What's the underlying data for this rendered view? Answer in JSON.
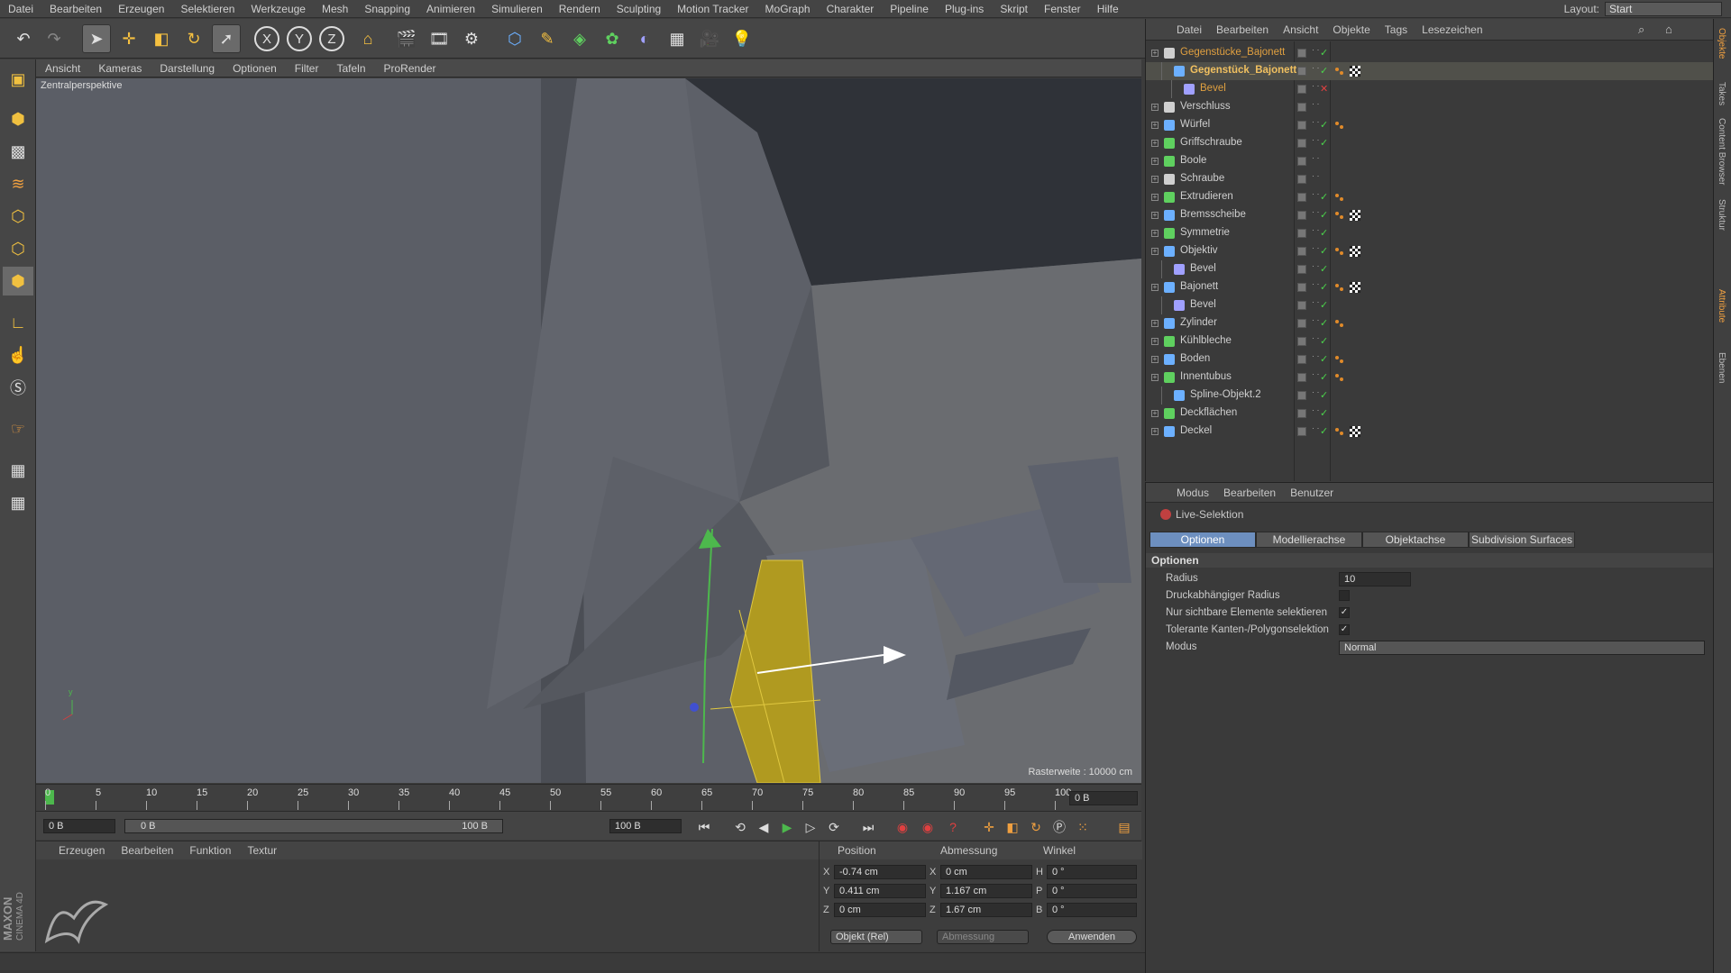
{
  "menu": [
    "Datei",
    "Bearbeiten",
    "Erzeugen",
    "Selektieren",
    "Werkzeuge",
    "Mesh",
    "Snapping",
    "Animieren",
    "Simulieren",
    "Rendern",
    "Sculpting",
    "Motion Tracker",
    "MoGraph",
    "Charakter",
    "Pipeline",
    "Plug-ins",
    "Skript",
    "Fenster",
    "Hilfe"
  ],
  "layout": {
    "label": "Layout:",
    "value": "Start"
  },
  "viewport_menu": [
    "Ansicht",
    "Kameras",
    "Darstellung",
    "Optionen",
    "Filter",
    "Tafeln",
    "ProRender"
  ],
  "viewport": {
    "label": "Zentralperspektive",
    "raster": "Rasterweite : 10000 cm"
  },
  "timeline": {
    "ticks": [
      "0",
      "5",
      "10",
      "15",
      "20",
      "25",
      "30",
      "35",
      "40",
      "45",
      "50",
      "55",
      "60",
      "65",
      "70",
      "75",
      "80",
      "85",
      "90",
      "95",
      "100"
    ],
    "current": "0 B"
  },
  "timebar": {
    "start": "0 B",
    "range_start": "0 B",
    "range_end": "100 B",
    "end": "100 B"
  },
  "material_menu": [
    "Erzeugen",
    "Bearbeiten",
    "Funktion",
    "Textur"
  ],
  "brand": {
    "line1": "MAXON",
    "line2": "CINEMA 4D"
  },
  "coords": {
    "headers": [
      "Position",
      "Abmessung",
      "Winkel"
    ],
    "rows": [
      {
        "a": "X",
        "pos": "-0.74 cm",
        "b": "X",
        "size": "0 cm",
        "c": "H",
        "rot": "0 °"
      },
      {
        "a": "Y",
        "pos": "0.411 cm",
        "b": "Y",
        "size": "1.167 cm",
        "c": "P",
        "rot": "0 °"
      },
      {
        "a": "Z",
        "pos": "0 cm",
        "b": "Z",
        "size": "1.67 cm",
        "c": "B",
        "rot": "0 °"
      }
    ],
    "mode": "Objekt (Rel)",
    "size_mode": "Abmessung",
    "apply": "Anwenden"
  },
  "object_menu": [
    "Datei",
    "Bearbeiten",
    "Ansicht",
    "Objekte",
    "Tags",
    "Lesezeichen"
  ],
  "objects": [
    {
      "name": "Gegenstücke_Bajonett",
      "indent": 0,
      "color": "#e0a040",
      "icon": "null-icon",
      "tags": "",
      "highlight": "orange"
    },
    {
      "name": "Gegenstück_Bajonett",
      "indent": 1,
      "color": "#f0c060",
      "icon": "spline-icon",
      "tags": "dots-checker",
      "highlight": "yellow"
    },
    {
      "name": "Bevel",
      "indent": 2,
      "color": "#e0a040",
      "icon": "bevel-icon",
      "tags": "",
      "highlight": "orange-dim",
      "cross": true
    },
    {
      "name": "Verschluss",
      "indent": 0,
      "color": "#cfcfcf",
      "icon": "null-icon",
      "tags": ""
    },
    {
      "name": "Würfel",
      "indent": 0,
      "color": "#cfcfcf",
      "icon": "cube-icon",
      "tags": "dots"
    },
    {
      "name": "Griffschraube",
      "indent": 0,
      "color": "#cfcfcf",
      "icon": "sphere-icon",
      "tags": ""
    },
    {
      "name": "Boole",
      "indent": 0,
      "color": "#cfcfcf",
      "icon": "boole-icon",
      "tags": ""
    },
    {
      "name": "Schraube",
      "indent": 0,
      "color": "#cfcfcf",
      "icon": "null-icon",
      "tags": ""
    },
    {
      "name": "Extrudieren",
      "indent": 0,
      "color": "#cfcfcf",
      "icon": "extrude-icon",
      "tags": "dots"
    },
    {
      "name": "Bremsscheibe",
      "indent": 0,
      "color": "#cfcfcf",
      "icon": "spline-icon",
      "tags": "dots-checker"
    },
    {
      "name": "Symmetrie",
      "indent": 0,
      "color": "#cfcfcf",
      "icon": "symmetry-icon",
      "tags": ""
    },
    {
      "name": "Objektiv",
      "indent": 0,
      "color": "#cfcfcf",
      "icon": "spline-icon",
      "tags": "dots-checker"
    },
    {
      "name": "Bevel",
      "indent": 1,
      "color": "#cfcfcf",
      "icon": "bevel-icon",
      "tags": ""
    },
    {
      "name": "Bajonett",
      "indent": 0,
      "color": "#cfcfcf",
      "icon": "spline-icon",
      "tags": "dots-checker"
    },
    {
      "name": "Bevel",
      "indent": 1,
      "color": "#cfcfcf",
      "icon": "bevel-icon",
      "tags": ""
    },
    {
      "name": "Zylinder",
      "indent": 0,
      "color": "#cfcfcf",
      "icon": "cylinder-icon",
      "tags": "dots"
    },
    {
      "name": "Kühlbleche",
      "indent": 0,
      "color": "#cfcfcf",
      "icon": "sphere-icon",
      "tags": ""
    },
    {
      "name": "Boden",
      "indent": 0,
      "color": "#cfcfcf",
      "icon": "cube-icon",
      "tags": "dots"
    },
    {
      "name": "Innentubus",
      "indent": 0,
      "color": "#cfcfcf",
      "icon": "extrude-icon",
      "tags": "dots"
    },
    {
      "name": "Spline-Objekt.2",
      "indent": 1,
      "color": "#cfcfcf",
      "icon": "spline-icon",
      "tags": ""
    },
    {
      "name": "Deckflächen",
      "indent": 0,
      "color": "#cfcfcf",
      "icon": "sphere-icon",
      "tags": ""
    },
    {
      "name": "Deckel",
      "indent": 0,
      "color": "#cfcfcf",
      "icon": "spline-icon",
      "tags": "dots-checker"
    }
  ],
  "attr_menu": [
    "Modus",
    "Bearbeiten",
    "Benutzer"
  ],
  "attr": {
    "tool": "Live-Selektion",
    "tabs": [
      "Optionen",
      "Modellierachse",
      "Objektachse",
      "Subdivision Surfaces"
    ],
    "section": "Optionen",
    "rows": [
      {
        "label": "Radius",
        "value": "10",
        "kind": "number"
      },
      {
        "label": "Druckabhängiger Radius",
        "kind": "check",
        "checked": false
      },
      {
        "label": "Nur sichtbare Elemente selektieren",
        "kind": "check",
        "checked": true
      },
      {
        "label": "Tolerante Kanten-/Polygonselektion",
        "kind": "check",
        "checked": true
      },
      {
        "label": "Modus",
        "value": "Normal",
        "kind": "select"
      }
    ]
  },
  "right_tabs": [
    "Objekte",
    "Takes",
    "Content Browser",
    "Struktur",
    "Attribute",
    "Ebenen"
  ],
  "colors": {
    "accent": "#6d8fbf",
    "selection": "#c8a820",
    "active_name": "#f0c060"
  }
}
